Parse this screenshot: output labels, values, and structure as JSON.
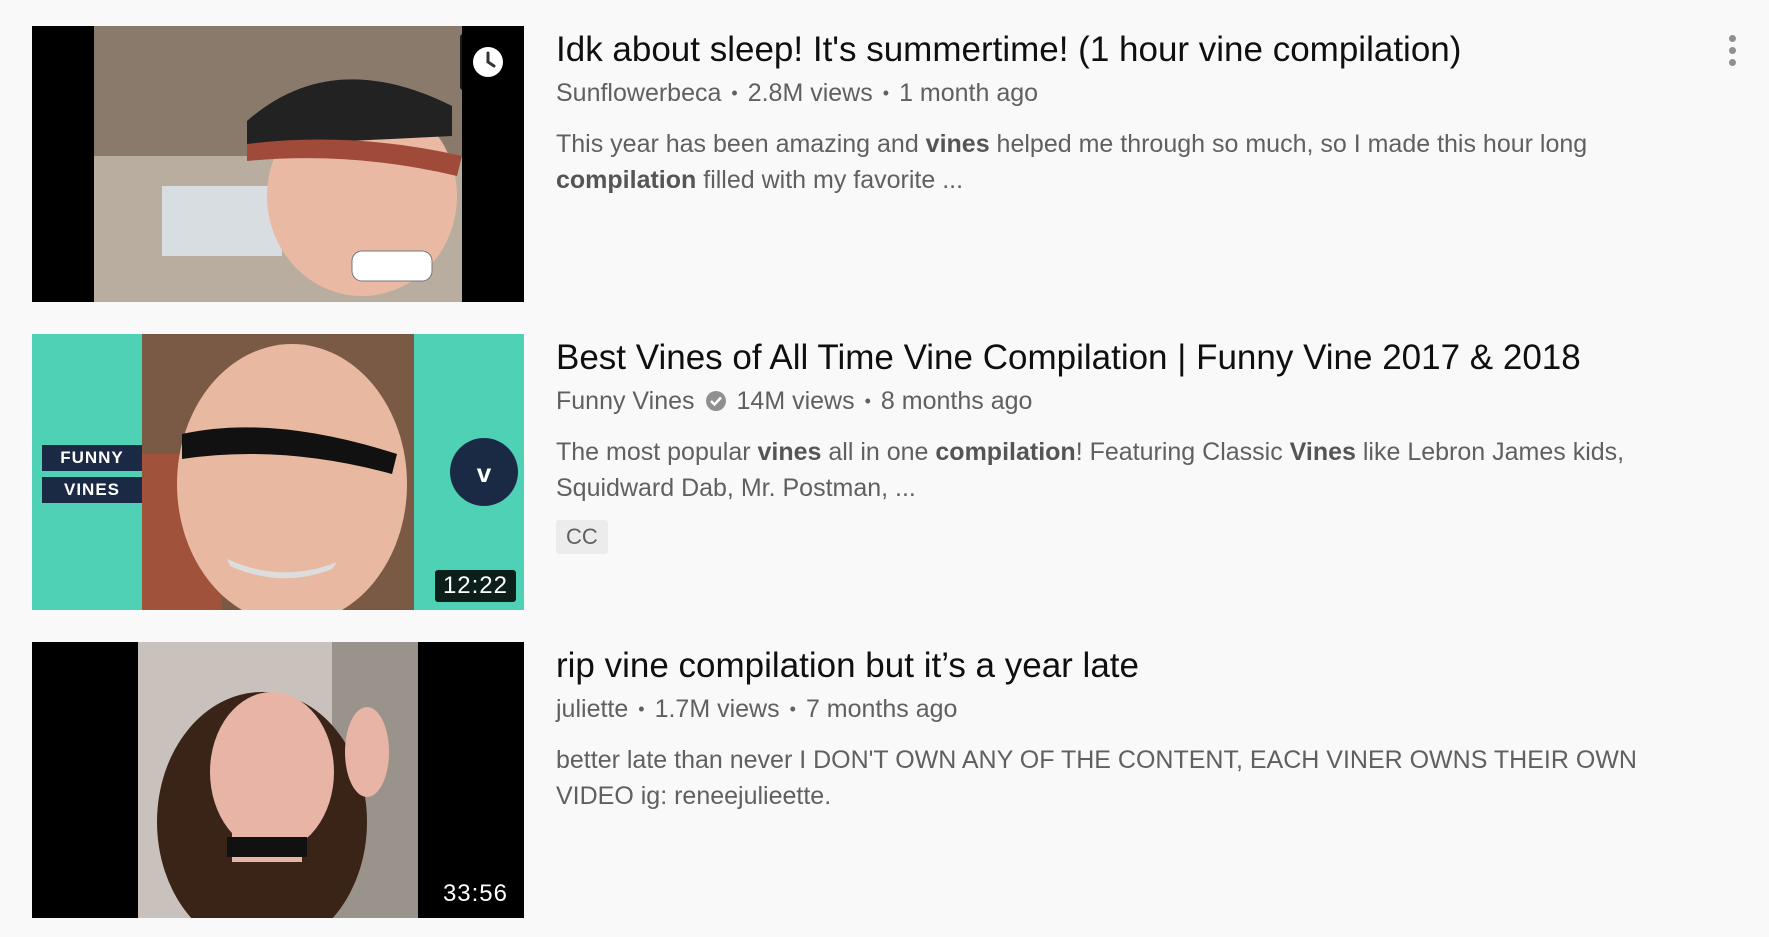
{
  "results": [
    {
      "title": "Idk about sleep! It's summertime! (1 hour vine compilation)",
      "channel": "Sunflowerbeca",
      "views": "2.8M views",
      "age": "1 month ago",
      "separator": "•",
      "description": {
        "p1": "This year has been amazing and ",
        "b1": "vines",
        "p2": " helped me through so much, so I made this hour long ",
        "b2": "compilation",
        "p3": " filled with my favorite ..."
      },
      "thumbnail_overlay_icon": "clock-icon"
    },
    {
      "title": "Best Vines of All Time Vine Compilation | Funny Vine 2017 & 2018",
      "channel": "Funny Vines",
      "verified_icon": "verified-check-icon",
      "views": "14M views",
      "age": "8 months ago",
      "separator": "•",
      "description": {
        "p1": "The most popular ",
        "b1": "vines",
        "p2": " all in one ",
        "b2": "compilation",
        "p3": "! Featuring Classic ",
        "b3": "Vines",
        "p4": " like Lebron James kids, Squidward Dab, Mr. Postman, ..."
      },
      "badge": "CC",
      "duration": "12:22",
      "thumb_logo_top": "FUNNY",
      "thumb_logo_bottom": "VINES"
    },
    {
      "title": "rip vine compilation but it’s a year late",
      "channel": "juliette",
      "views": "1.7M views",
      "age": "7 months ago",
      "separator": "•",
      "description": {
        "p1": "better late than never I DON'T OWN ANY OF THE CONTENT, EACH VINER OWNS THEIR OWN VIDEO ig: reneejulieette."
      },
      "duration": "33:56"
    }
  ],
  "colors": {
    "background": "#f9f9f9",
    "title": "#0f0f0f",
    "secondary_text": "#606060",
    "thumb_teal": "#4fd1b5"
  }
}
